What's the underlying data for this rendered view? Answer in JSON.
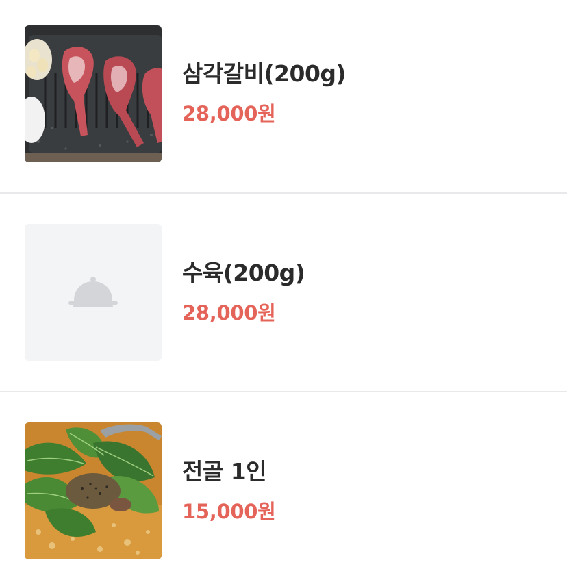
{
  "menu": {
    "items": [
      {
        "name": "삼각갈비(200g)",
        "price": "28,000원",
        "image": "grilled-meat-photo"
      },
      {
        "name": "수육(200g)",
        "price": "28,000원",
        "image": "placeholder-cloche-icon"
      },
      {
        "name": "전골 1인",
        "price": "15,000원",
        "image": "stew-photo"
      }
    ]
  },
  "colors": {
    "price": "#e5645a",
    "name": "#2b2b2b",
    "divider": "#e9e9eb",
    "placeholder_bg": "#f3f4f6",
    "placeholder_icon": "#d4d5d8"
  }
}
